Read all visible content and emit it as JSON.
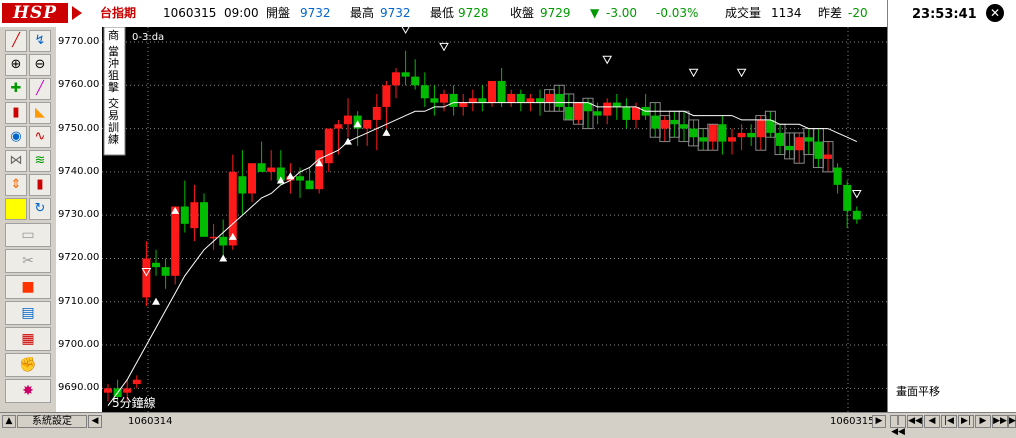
{
  "header": {
    "logo": "HSP",
    "symbol": "台指期",
    "date": "1060315",
    "time": "09:00",
    "open_label": "開盤",
    "open": "9732",
    "high_label": "最高",
    "high": "9732",
    "low_label": "最低",
    "low": "9728",
    "close_label": "收盤",
    "close": "9729",
    "change_arrow": "▼",
    "change": "-3.00",
    "change_pct": "-0.03%",
    "volume_label": "成交量",
    "volume": "1134",
    "prev_diff_label": "昨差",
    "prev_diff": "-20",
    "clock": "23:53:41"
  },
  "chart": {
    "indicator": "0-3:da",
    "interval_label": "5分鐘線",
    "side_tags": [
      "商",
      "當沖狙擊",
      "交易訓練"
    ],
    "y_ticks": [
      "9770.00",
      "9760.00",
      "9750.00",
      "9740.00",
      "9730.00",
      "9720.00",
      "9710.00",
      "9700.00",
      "9690.00"
    ],
    "colors": {
      "up": "#ff1a1a",
      "down": "#00bb00",
      "ma": "#ffffff",
      "grid": "#888888"
    }
  },
  "right_panel": {
    "label": "畫面平移"
  },
  "bottom": {
    "settings_label": "系統設定",
    "date_start": "1060314",
    "date_end": "1060315",
    "nav": [
      "|◀◀",
      "◀◀",
      "◀",
      "|◀",
      "▶|",
      "▶",
      "▶▶",
      "▶▶|"
    ]
  },
  "chart_data": {
    "type": "candlestick",
    "ylim": [
      9685,
      9773
    ],
    "candles": [
      [
        9689,
        9691,
        9687,
        9690
      ],
      [
        9690,
        9692,
        9687,
        9688
      ],
      [
        9689,
        9692,
        9687,
        9690
      ],
      [
        9691,
        9693,
        9690,
        9692
      ],
      [
        9711,
        9724,
        9709,
        9720
      ],
      [
        9719,
        9722,
        9716,
        9718
      ],
      [
        9718,
        9720,
        9713,
        9716
      ],
      [
        9716,
        9732,
        9714,
        9732
      ],
      [
        9732,
        9738,
        9726,
        9728
      ],
      [
        9727,
        9737,
        9724,
        9733
      ],
      [
        9733,
        9735,
        9728,
        9725
      ],
      [
        9725,
        9728,
        9722,
        9725
      ],
      [
        9725,
        9729,
        9720,
        9723
      ],
      [
        9723,
        9744,
        9722,
        9740
      ],
      [
        9739,
        9745,
        9730,
        9735
      ],
      [
        9735,
        9740,
        9733,
        9742
      ],
      [
        9742,
        9747,
        9740,
        9740
      ],
      [
        9740,
        9745,
        9738,
        9741
      ],
      [
        9741,
        9745,
        9737,
        9738
      ],
      [
        9738,
        9742,
        9735,
        9739
      ],
      [
        9739,
        9741,
        9734,
        9738
      ],
      [
        9738,
        9741,
        9736,
        9736
      ],
      [
        9736,
        9744,
        9735,
        9745
      ],
      [
        9742,
        9748,
        9740,
        9750
      ],
      [
        9750,
        9752,
        9744,
        9751
      ],
      [
        9751,
        9757,
        9748,
        9753
      ],
      [
        9753,
        9754,
        9746,
        9750
      ],
      [
        9750,
        9752,
        9746,
        9752
      ],
      [
        9752,
        9758,
        9745,
        9755
      ],
      [
        9755,
        9761,
        9750,
        9760
      ],
      [
        9760,
        9764,
        9757,
        9763
      ],
      [
        9763,
        9768,
        9760,
        9762
      ],
      [
        9762,
        9766,
        9759,
        9760
      ],
      [
        9760,
        9763,
        9755,
        9757
      ],
      [
        9757,
        9760,
        9753,
        9756
      ],
      [
        9756,
        9759,
        9754,
        9758
      ],
      [
        9758,
        9760,
        9753,
        9755
      ],
      [
        9755,
        9758,
        9753,
        9756
      ],
      [
        9756,
        9759,
        9754,
        9757
      ],
      [
        9757,
        9760,
        9754,
        9756
      ],
      [
        9756,
        9760,
        9755,
        9761
      ],
      [
        9761,
        9764,
        9755,
        9756
      ],
      [
        9756,
        9759,
        9755,
        9758
      ],
      [
        9758,
        9759,
        9754,
        9756
      ],
      [
        9756,
        9758,
        9754,
        9757
      ],
      [
        9757,
        9759,
        9753,
        9756
      ],
      [
        9756,
        9759,
        9754,
        9758
      ],
      [
        9758,
        9760,
        9754,
        9755
      ],
      [
        9755,
        9758,
        9752,
        9752
      ],
      [
        9752,
        9756,
        9751,
        9756
      ],
      [
        9756,
        9757,
        9750,
        9754
      ],
      [
        9754,
        9756,
        9751,
        9753
      ],
      [
        9753,
        9757,
        9751,
        9756
      ],
      [
        9756,
        9758,
        9752,
        9755
      ],
      [
        9755,
        9757,
        9750,
        9752
      ],
      [
        9752,
        9756,
        9750,
        9755
      ],
      [
        9755,
        9758,
        9752,
        9753
      ],
      [
        9753,
        9756,
        9748,
        9750
      ],
      [
        9750,
        9753,
        9747,
        9752
      ],
      [
        9752,
        9754,
        9748,
        9751
      ],
      [
        9751,
        9754,
        9747,
        9750
      ],
      [
        9750,
        9752,
        9746,
        9748
      ],
      [
        9748,
        9750,
        9745,
        9747
      ],
      [
        9747,
        9751,
        9745,
        9751
      ],
      [
        9751,
        9753,
        9744,
        9747
      ],
      [
        9747,
        9750,
        9744,
        9748
      ],
      [
        9748,
        9751,
        9745,
        9749
      ],
      [
        9749,
        9751,
        9746,
        9748
      ],
      [
        9748,
        9753,
        9745,
        9752
      ],
      [
        9752,
        9754,
        9748,
        9749
      ],
      [
        9749,
        9751,
        9744,
        9746
      ],
      [
        9746,
        9749,
        9743,
        9745
      ],
      [
        9745,
        9749,
        9742,
        9748
      ],
      [
        9748,
        9750,
        9744,
        9747
      ],
      [
        9747,
        9750,
        9741,
        9743
      ],
      [
        9743,
        9747,
        9740,
        9744
      ],
      [
        9741,
        9742,
        9735,
        9737
      ],
      [
        9737,
        9738,
        9727,
        9731
      ],
      [
        9731,
        9732,
        9728,
        9729
      ]
    ],
    "ma": [
      9686,
      9689,
      9692,
      9696,
      9700,
      9704,
      9708,
      9712,
      9716,
      9719,
      9722,
      9724,
      9726,
      9728,
      9730,
      9732,
      9734,
      9735,
      9737,
      9738,
      9740,
      9741,
      9743,
      9744,
      9745,
      9747,
      9748,
      9749,
      9750,
      9751,
      9752,
      9753,
      9754,
      9754,
      9755,
      9755,
      9756,
      9756,
      9756,
      9756,
      9756,
      9756,
      9756,
      9756,
      9756,
      9756,
      9756,
      9756,
      9756,
      9756,
      9756,
      9755,
      9755,
      9755,
      9755,
      9755,
      9754,
      9754,
      9754,
      9754,
      9754,
      9753,
      9753,
      9753,
      9753,
      9753,
      9752,
      9752,
      9752,
      9752,
      9751,
      9751,
      9751,
      9750,
      9750,
      9750,
      9749,
      9748,
      9747
    ],
    "buy_markers": [
      [
        5,
        9710
      ],
      [
        7,
        9731
      ],
      [
        12,
        9720
      ],
      [
        13,
        9725
      ],
      [
        18,
        9738
      ],
      [
        19,
        9739
      ],
      [
        22,
        9742
      ],
      [
        25,
        9747
      ],
      [
        26,
        9751
      ],
      [
        29,
        9749
      ]
    ],
    "sell_markers": [
      [
        4,
        9717
      ],
      [
        31,
        9773
      ],
      [
        35,
        9769
      ],
      [
        52,
        9766
      ],
      [
        61,
        9763
      ],
      [
        66,
        9763
      ],
      [
        78,
        9735
      ]
    ],
    "outline_candles": [
      46,
      47,
      48,
      49,
      50,
      57,
      58,
      59,
      60,
      61,
      62,
      63,
      68,
      69,
      70,
      71,
      72,
      73,
      74,
      75
    ]
  }
}
